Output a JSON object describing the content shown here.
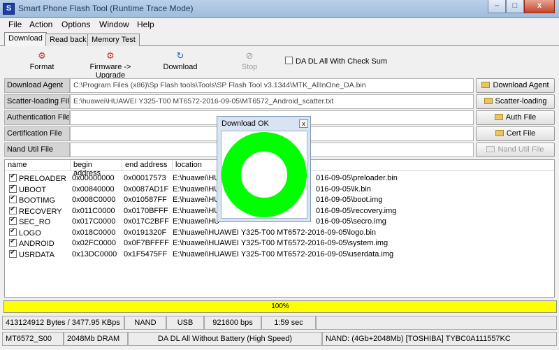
{
  "window": {
    "title": "Smart Phone Flash Tool (Runtime Trace Mode)",
    "minimize_label": "–",
    "maximize_label": "□",
    "close_label": "x"
  },
  "menu": [
    "File",
    "Action",
    "Options",
    "Window",
    "Help"
  ],
  "tabs": [
    "Download",
    "Read back",
    "Memory Test"
  ],
  "toolbar": {
    "format": "Format",
    "firmware_upgrade": "Firmware -> Upgrade",
    "download": "Download",
    "stop": "Stop",
    "checksum_label": "DA DL All With Check Sum",
    "format_icon": "⚙",
    "firmware_icon": "⚙",
    "download_icon": "↻",
    "stop_icon": "⊘"
  },
  "files": {
    "download_agent": {
      "label": "Download Agent",
      "value": "C:\\Program Files (x86)\\Sp Flash tools\\Tools\\SP Flash Tool v3.1344\\MTK_AllInOne_DA.bin",
      "button": "Download Agent"
    },
    "scatter": {
      "label": "Scatter-loading File",
      "value": "E:\\huawei\\HUAWEI Y325-T00 MT6572-2016-09-05\\MT6572_Android_scatter.txt",
      "button": "Scatter-loading"
    },
    "auth": {
      "label": "Authentication File",
      "value": "",
      "button": "Auth File"
    },
    "cert": {
      "label": "Certification File",
      "value": "",
      "button": "Cert File"
    },
    "nand": {
      "label": "Nand Util File",
      "value": "",
      "button": "Nand Util File"
    }
  },
  "table": {
    "columns": [
      "name",
      "begin address",
      "end address",
      "location"
    ],
    "rows": [
      {
        "name": "PRELOADER",
        "begin": "0x00000000",
        "end": "0x00017573",
        "loc_a": "E:\\huawei\\HU",
        "loc_b": "016-09-05\\preloader.bin"
      },
      {
        "name": "UBOOT",
        "begin": "0x00840000",
        "end": "0x0087AD1F",
        "loc_a": "E:\\huawei\\HU",
        "loc_b": "016-09-05\\lk.bin"
      },
      {
        "name": "BOOTIMG",
        "begin": "0x008C0000",
        "end": "0x010587FF",
        "loc_a": "E:\\huawei\\HU",
        "loc_b": "016-09-05\\boot.img"
      },
      {
        "name": "RECOVERY",
        "begin": "0x011C0000",
        "end": "0x0170BFFF",
        "loc_a": "E:\\huawei\\HU",
        "loc_b": "016-09-05\\recovery.img"
      },
      {
        "name": "SEC_RO",
        "begin": "0x017C0000",
        "end": "0x017C2BFF",
        "loc_a": "E:\\huawei\\HU",
        "loc_b": "016-09-05\\secro.img"
      },
      {
        "name": "LOGO",
        "begin": "0x018C0000",
        "end": "0x0191320F",
        "loc_a": "E:\\huawei\\HUAWEI Y325-T00 MT6572-2016-09-05\\logo.bin",
        "loc_b": ""
      },
      {
        "name": "ANDROID",
        "begin": "0x02FC0000",
        "end": "0x0F7BFFFF",
        "loc_a": "E:\\huawei\\HUAWEI Y325-T00 MT6572-2016-09-05\\system.img",
        "loc_b": ""
      },
      {
        "name": "USRDATA",
        "begin": "0x13DC0000",
        "end": "0x1F5475FF",
        "loc_a": "E:\\huawei\\HUAWEI Y325-T00 MT6572-2016-09-05\\userdata.img",
        "loc_b": ""
      }
    ]
  },
  "popup": {
    "title": "Download OK",
    "close_label": "x",
    "ring_color": "#00ff00"
  },
  "progress": {
    "text": "100%",
    "fraction": 1.0,
    "color": "#ffff00"
  },
  "status1": {
    "bytes": "413124912 Bytes / 3477.95 KBps",
    "storage": "NAND",
    "port": "USB",
    "baud": "921600 bps",
    "time": "1:59 sec"
  },
  "status2": {
    "chip": "MT6572_S00",
    "dram": "2048Mb DRAM",
    "mode": "DA DL All Without Battery (High Speed)",
    "nand": "NAND: (4Gb+2048Mb) [TOSHIBA] TYBC0A111557KC"
  }
}
